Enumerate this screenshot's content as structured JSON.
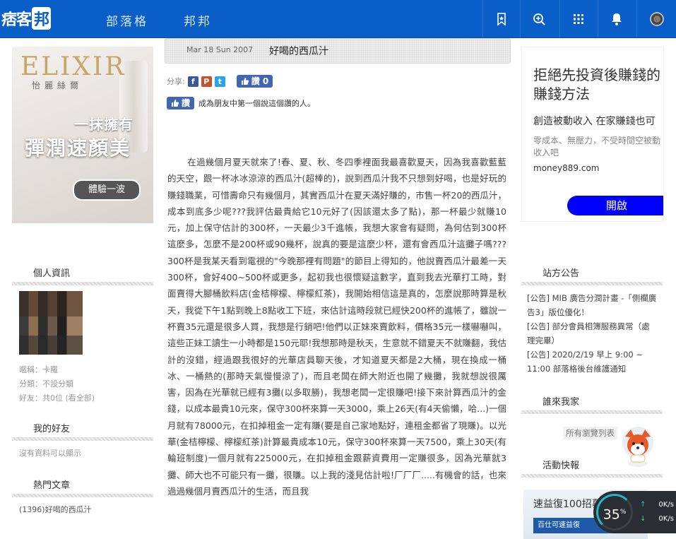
{
  "topbar": {
    "logo_prefix": "痞客",
    "logo_box": "邦",
    "nav": [
      "部落格",
      "邦邦"
    ],
    "icons": [
      "bookmark-star-icon",
      "search-plus-icon",
      "apps-grid-icon",
      "bell-icon",
      "user-avatar-icon"
    ]
  },
  "left_ad": {
    "brand": "ELIXIR",
    "sub": "怡麗絲爾",
    "line1": "一抹擁有",
    "line2": "彈潤速顏美",
    "cta": "體驗一波"
  },
  "profile": {
    "title": "個人資訊",
    "nickname_label": "暱稱：",
    "nickname": "卡羅",
    "category_label": "分類：",
    "category": "不設分類",
    "friends_label": "好友：",
    "friends": "共0位 (看全部)"
  },
  "friends_section": {
    "title": "我的好友",
    "empty": "沒有資料可以顯示"
  },
  "hot_section": {
    "title": "熱門文章",
    "item1": "(1396)好喝的西瓜汁"
  },
  "post": {
    "date": "Mar 18 Sun 2007",
    "title": "好喝的西瓜汁",
    "share_label": "分享:",
    "like_label": "讚 0",
    "like_btn": "讚",
    "like_hint": "成為朋友中第一個說這個讚的人。",
    "body": "在過幾個月夏天就來了!春、夏、秋、冬四季裡面我最喜歡夏天，因為我喜歡藍藍的天空，跟一杯冰冰涼涼的西瓜汁(超棒的)，說到西瓜汁我不只想到好喝，也是好玩的賺錢職業，可惜壽命只有幾個月，其實西瓜汁在夏天滿好賺的，市售一杯20的西瓜汁，成本到底多少呢???我評估最貴給它10元好了(因該還太多了點)，那一杯最少就賺10元，加上保守估計的300杯，一天最少3千進帳，我想大家會有疑問，為何估到300杯這麼多，怎麼不是200杯或90幾杯，說真的要是這麼少杯，還有會西瓜汁這攤子嗎???300杯是我某天看到電視的\"今晚那裡有問題\"的節目上得知的，他說賣西瓜汁最差一天300杯，會好400~500杯或更多，起初我也很懷疑這數字，直到我去光華打工時，對面賣得大腳桶飲料店(金桔檸檬、檸檬紅茶)，我開始相信這是真的，怎麼說那時算是秋天，我從下午1點到晚上8點收工下班，來估計這時段就已經快200杯的進帳了，雖說一杯賣35元還是很多人買，我想是行銷吧!他們以正妹來賣飲料，價格35元一樣嚇嚇叫，這些正妹工讀生一小時都是150元耶!我想那時是秋天，生意就不錯夏天不就賺翻，我估計的沒錯，經過跟我很好的光華店員聊天後，才知道夏天都是2大桶，現在換成一桶冰、一桶熱的(那時天氣慢慢涼了)，而且老闆在師大附近也開了幾攤，我就想說很厲害，因為在光華就已經有3攤(以多取勝)，我想老闆一定很賺吧!接下來計算西瓜汁的金錢，以成本最貴10元來，保守300杯來算一天3000，乘上26天(有4天偷懶，哈...)一個月就有78000元，在扣掉租金一定有賺(要是自己家地點好，連租金都省了現賺)。以光華(金桔檸檬、檸檬紅茶)計算最貴成本10元，保守300杯來算一天7500，乘上30天(有輪班制度)一個月就有225000元，在扣掉租金跟薪資費用一定賺很多，因為光華就3攤、師大也不可能只有一攤，很賺。以上我的淺見估計啦!厂厂厂.....有機會的話，也來過過幾個月賣西瓜汁的生活，而且我"
  },
  "right_ad": {
    "headline": "拒絕先投資後賺錢的賺錢方法",
    "desc": "創造被動收入 在家賺錢也可",
    "desc2": "零成本、無壓力，不受時間空被動收入吧",
    "url": "money889.com",
    "button": "開啟"
  },
  "announcements": {
    "title": "站方公告",
    "items": [
      "[公告] MIB 廣告分潤計畫 -「側欄廣告3」版位優化！",
      "[公告] 部分會員相簿服務異常（處理完畢）",
      "[公告] 2020/2/19 早上 9:00 ~ 11:00 部落格後台維護通知"
    ]
  },
  "visitors": {
    "title": "誰來我家",
    "all": "所有瀏覽列表"
  },
  "events": {
    "title": "活動快報",
    "promo_title": "速益復100招募中",
    "promo_banner": "百仕可速益復"
  },
  "speed": {
    "percent": "35",
    "unit": "%",
    "up": "0",
    "down": "0",
    "rate_unit": "K/s"
  }
}
